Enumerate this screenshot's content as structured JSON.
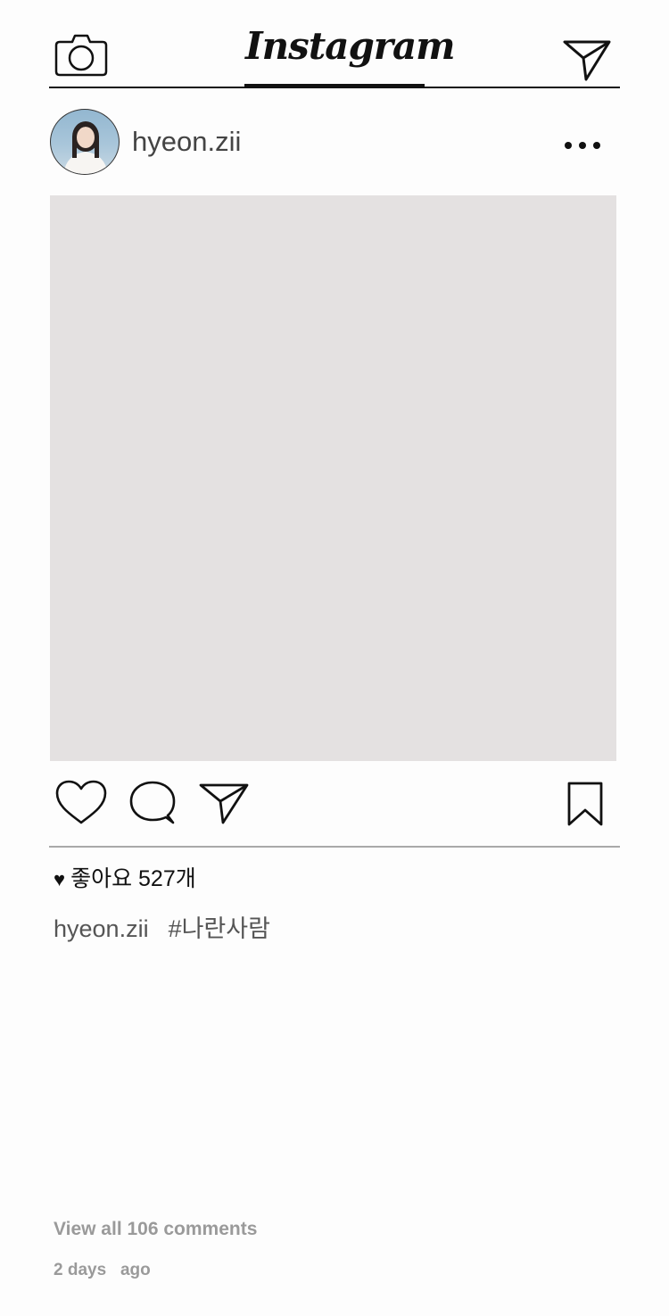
{
  "header": {
    "logo_text": "Instagram",
    "camera_icon": "camera-icon",
    "direct_icon": "paper-plane-icon"
  },
  "post": {
    "username": "hyeon.zii",
    "avatar": "avatar",
    "more_icon": "more-horizontal-icon",
    "image_placeholder_color": "#e4e1e1",
    "actions": {
      "like_icon": "heart-outline-icon",
      "comment_icon": "comment-bubble-icon",
      "share_icon": "paper-plane-icon",
      "save_icon": "bookmark-icon"
    },
    "likes_text": "좋아요 527개",
    "caption": {
      "username": "hyeon.zii",
      "hashtag": "#나란사람"
    },
    "view_comments": "View all 106 comments",
    "timestamp": "2 days   ago"
  }
}
